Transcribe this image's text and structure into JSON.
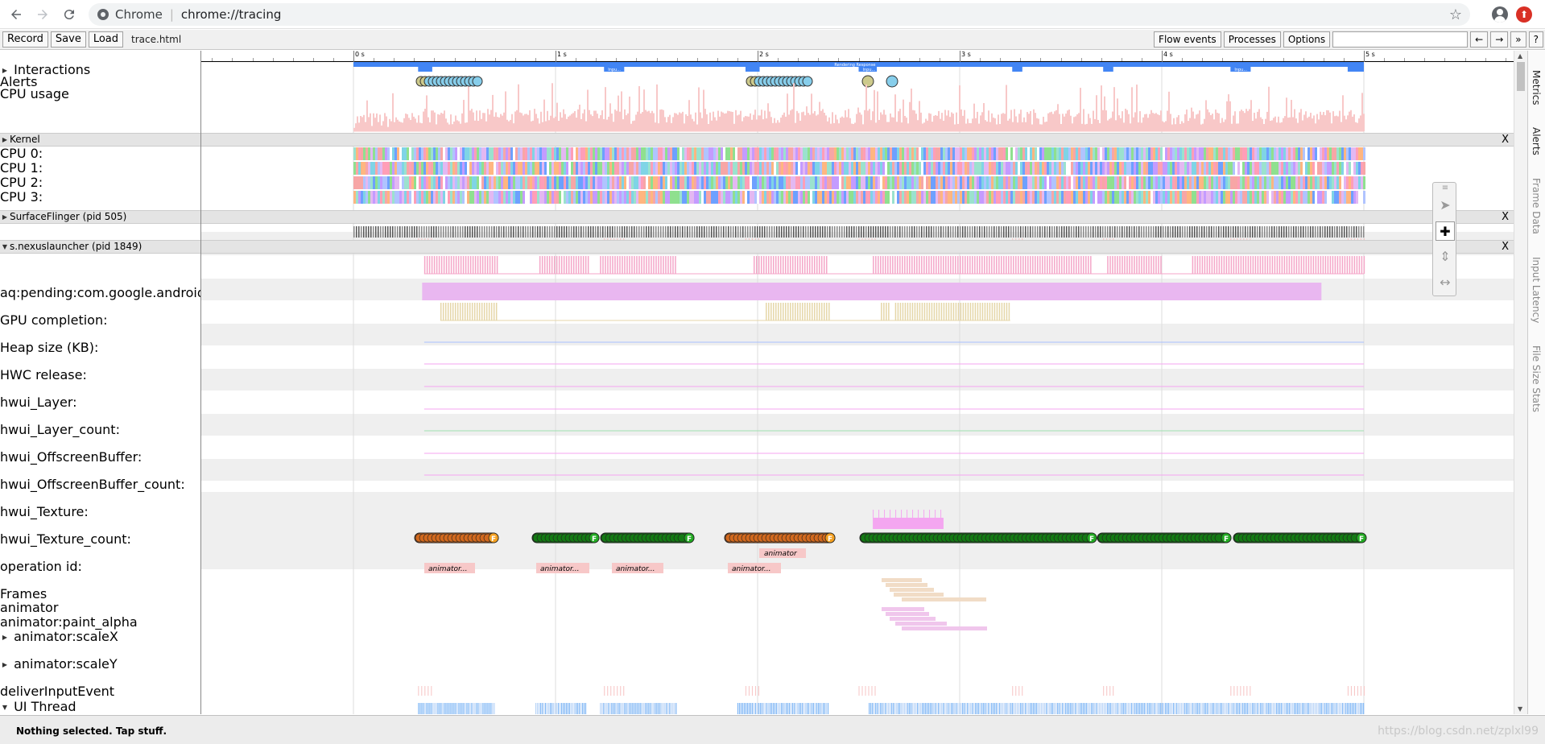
{
  "browser": {
    "site_name": "Chrome",
    "url": "chrome://tracing"
  },
  "toolbar": {
    "record_label": "Record",
    "save_label": "Save",
    "load_label": "Load",
    "trace_title": "trace.html",
    "flow_events_label": "Flow events",
    "processes_label": "Processes",
    "options_label": "Options",
    "search_placeholder": "",
    "prev_label": "←",
    "next_label": "→",
    "expand_label": "»",
    "help_label": "?"
  },
  "ruler": {
    "ticks": [
      "0 s",
      "1 s",
      "2 s",
      "3 s",
      "4 s",
      "5 s"
    ]
  },
  "tracks": {
    "interactions": "Interactions",
    "alerts": "Alerts",
    "cpu_usage": "CPU usage",
    "kernel": "Kernel",
    "cpu0": "CPU 0:",
    "cpu1": "CPU 1:",
    "cpu2": "CPU 2:",
    "cpu3": "CPU 3:",
    "surfaceflinger": "SurfaceFlinger (pid 505)",
    "launcher": "s.nexuslauncher (pid 1849)",
    "aq_pending": "aq:pending:com.google.android",
    "gpu_completion": "GPU completion:",
    "heap_size": "Heap size (KB):",
    "hwc_release": "HWC release:",
    "hwui_layer": "hwui_Layer:",
    "hwui_layer_count": "hwui_Layer_count:",
    "hwui_offscreen": "hwui_OffscreenBuffer:",
    "hwui_offscreen_count": "hwui_OffscreenBuffer_count:",
    "hwui_texture": "hwui_Texture:",
    "hwui_texture_count": "hwui_Texture_count:",
    "operation_id": "operation id:",
    "frames": "Frames",
    "animator": "animator",
    "animator_paint_alpha": "animator:paint_alpha",
    "animator_scalex": "animator:scaleX",
    "animator_scaley": "animator:scaleY",
    "deliver_input": "deliverInputEvent",
    "ui_thread": "UI Thread"
  },
  "interaction_labels": [
    "Rendering Response",
    "Inpu...",
    "Inpu...",
    "Inpu..."
  ],
  "frame_marker": "F",
  "animator_slices": [
    "animator...",
    "animator...",
    "animator...",
    "animator..."
  ],
  "animator_slice_top": "animator",
  "close_label": "X",
  "side_tabs": [
    "Metrics",
    "Alerts",
    "Frame Data",
    "Input Latency",
    "File Size Stats"
  ],
  "status": {
    "text": "Nothing selected. Tap stuff.",
    "watermark": "https://blog.csdn.net/zplxl99"
  },
  "colors": {
    "interaction_blue": "#4285f4",
    "cpu_usage_pink": "#f8c8c8",
    "alert_light": "#87ceeb",
    "alert_yellow": "#cdca8c",
    "frame_good": "#137a13",
    "frame_bad": "#d2691e",
    "heap_purple": "#e9b7f0",
    "gpu_pink": "#f4a6c8",
    "hwc_tan": "#e5d6a8"
  }
}
